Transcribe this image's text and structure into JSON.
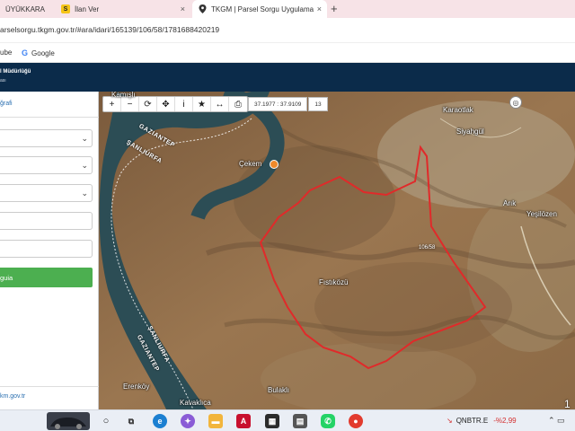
{
  "browser": {
    "tabs": [
      {
        "label": "ÜYÜKKARA",
        "favicon": "grid",
        "active": false
      },
      {
        "label": "İlan Ver",
        "favicon": "S",
        "active": false
      },
      {
        "label": "TKGM | Parsel Sorgu Uygulama",
        "favicon": "location-pin",
        "active": true
      }
    ],
    "new_tab": "+",
    "close": "×",
    "url": "arselsorgu.tkgm.gov.tr/#ara/idari/165139/106/58/1781688420219"
  },
  "bookmarks": [
    {
      "label": "ube"
    },
    {
      "label": "Google",
      "icon": "G"
    }
  ],
  "header": {
    "title": "l Müdürlüğü",
    "subtitle": "ası"
  },
  "sidebar": {
    "title": "ğrafi",
    "button_label": "guia",
    "footer": "km.gov.tr"
  },
  "map": {
    "toolbar": [
      "+",
      "−",
      "⟳",
      "✥",
      "i",
      "★",
      "↔",
      "⎙"
    ],
    "coordinates": "37.1977 : 37.9109",
    "zoom_level": "13",
    "parcel_label": "106/58",
    "parcel_color": "#e02a2a",
    "places": [
      {
        "name": "Karaotlak"
      },
      {
        "name": "Siyahgül"
      },
      {
        "name": "Arık"
      },
      {
        "name": "Yeşilözen"
      },
      {
        "name": "Çekem"
      },
      {
        "name": "Fıstıközü"
      },
      {
        "name": "Erenköy"
      },
      {
        "name": "Kavaklıca"
      },
      {
        "name": "Bulaklı"
      },
      {
        "name": "Kamışlı"
      }
    ],
    "roads": [
      {
        "name": "GAZIANTEP"
      },
      {
        "name": "ŞANLIURFA"
      },
      {
        "name": "ŞANLIURFA"
      },
      {
        "name": "GAZIANTEP"
      }
    ]
  },
  "taskbar": {
    "ticker_symbol": "QNBTR.E",
    "ticker_change": "-%2,99",
    "tray_text": "1"
  }
}
